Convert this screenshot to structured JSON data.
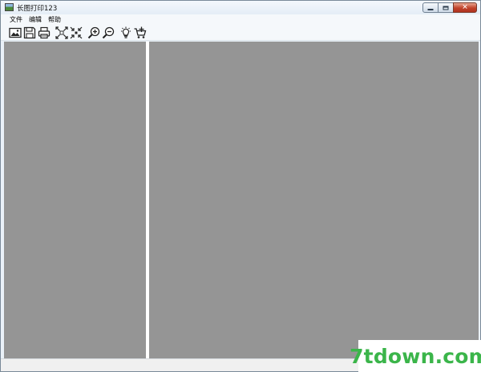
{
  "window": {
    "title": "长图打印123",
    "controls": {
      "minimize_icon": "minimize-icon",
      "maximize_icon": "maximize-icon",
      "close_icon": "close-icon"
    }
  },
  "menubar": {
    "items": [
      {
        "label": "文件"
      },
      {
        "label": "编辑"
      },
      {
        "label": "帮助"
      }
    ]
  },
  "toolbar": {
    "tools": [
      {
        "icon": "open-image-icon"
      },
      {
        "icon": "save-icon"
      },
      {
        "icon": "print-icon"
      },
      {
        "icon": "fit-to-window-icon"
      },
      {
        "icon": "actual-size-icon"
      },
      {
        "icon": "zoom-in-icon"
      },
      {
        "icon": "zoom-out-icon"
      },
      {
        "icon": "idea-bulb-icon"
      },
      {
        "icon": "add-to-cart-icon"
      }
    ]
  },
  "panes": {
    "background_color": "#959595",
    "splitter_color": "#ffffff"
  },
  "watermark": {
    "text": "7tdown.com",
    "color": "#3bb54a"
  }
}
